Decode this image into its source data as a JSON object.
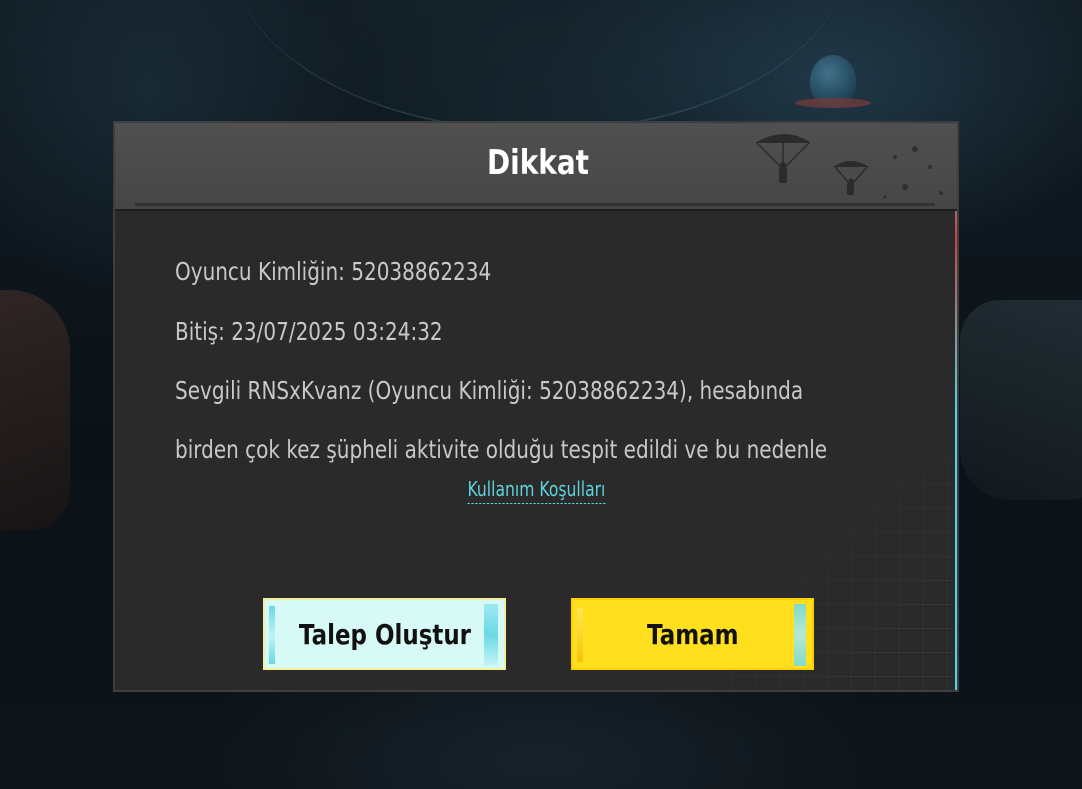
{
  "dialog": {
    "title": "Dikkat",
    "lines": {
      "player_id": "Oyuncu Kimliğin: 52038862234",
      "expiry": "Bitiş: 23/07/2025 03:24:32",
      "message_1": "Sevgili RNSxKvanz (Oyuncu Kimliği: 52038862234), hesabında",
      "message_2": "birden çok kez şüpheli aktivite olduğu tespit edildi ve bu nedenle"
    },
    "terms_link": "Kullanım Koşulları",
    "buttons": {
      "ticket_label": "Talep Oluştur",
      "ok_label": "Tamam"
    }
  },
  "colors": {
    "dialog_bg": "#2a2a2a",
    "header_bg": "#4a4a4a",
    "link": "#5ed3dc",
    "ticket_button": "#d8faf6",
    "ok_button": "#ffdf1e"
  },
  "icons": {
    "header_decoration": "paratrooper-icon"
  }
}
